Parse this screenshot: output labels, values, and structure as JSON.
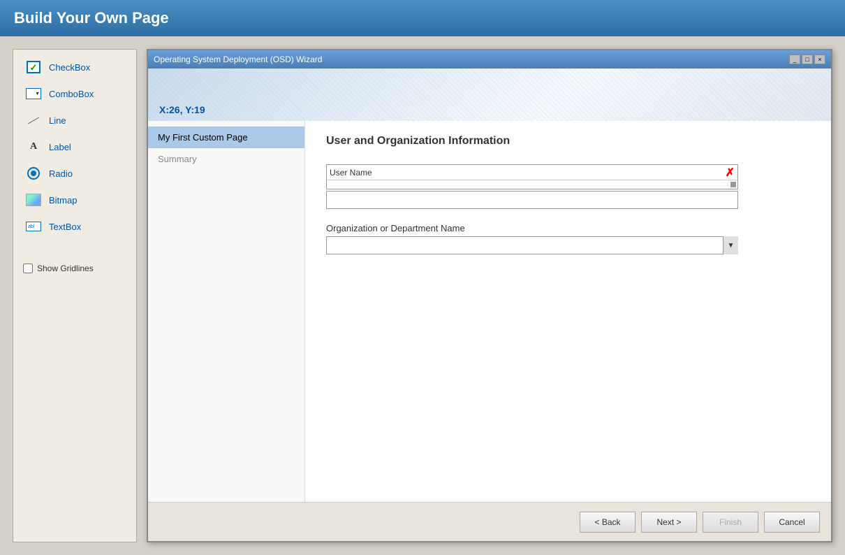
{
  "header": {
    "title": "Build Your Own Page"
  },
  "toolbox": {
    "items": [
      {
        "id": "checkbox",
        "label": "CheckBox",
        "icon": "checkbox-icon"
      },
      {
        "id": "combobox",
        "label": "ComboBox",
        "icon": "combobox-icon"
      },
      {
        "id": "line",
        "label": "Line",
        "icon": "line-icon"
      },
      {
        "id": "label",
        "label": "Label",
        "icon": "label-icon"
      },
      {
        "id": "radio",
        "label": "Radio",
        "icon": "radio-icon"
      },
      {
        "id": "bitmap",
        "label": "Bitmap",
        "icon": "bitmap-icon"
      },
      {
        "id": "textbox",
        "label": "TextBox",
        "icon": "textbox-icon"
      }
    ],
    "show_gridlines_label": "Show Gridlines"
  },
  "wizard": {
    "title": "Operating System Deployment (OSD) Wizard",
    "titlebar_buttons": [
      "_",
      "□",
      "×"
    ],
    "coordinates": "X:26, Y:19",
    "nav_items": [
      {
        "id": "custom-page",
        "label": "My First Custom Page",
        "active": true
      },
      {
        "id": "summary",
        "label": "Summary",
        "active": false
      }
    ],
    "section_title": "User and Organization Information",
    "fields": [
      {
        "id": "username",
        "label": "User Name",
        "type": "text",
        "has_error": true
      },
      {
        "id": "orgname",
        "label": "Organization or Department Name",
        "type": "combobox"
      }
    ],
    "buttons": {
      "back": "< Back",
      "next": "Next >",
      "finish": "Finish",
      "cancel": "Cancel"
    }
  }
}
